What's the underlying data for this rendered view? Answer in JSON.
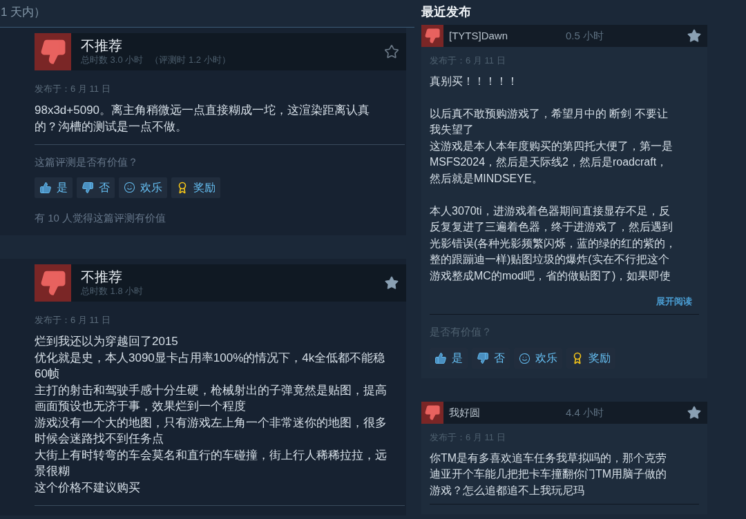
{
  "filter_label": "1 天内）",
  "left_reviews": [
    {
      "recommended": false,
      "verdict": "不推荐",
      "hours": "总时数 3.0 小时",
      "review_hours": "（评测时 1.2 小时）",
      "starred": false,
      "date": "发布于：6 月 11 日",
      "paragraphs": [
        "98x3d+5090。离主角稍微远一点直接糊成一坨，这渲染距离认真的？沟槽的测试是一点不做。"
      ],
      "helpful_prompt": "这篇评测是否有价值？",
      "buttons": [
        {
          "kind": "yes",
          "label": "是"
        },
        {
          "kind": "no",
          "label": "否"
        },
        {
          "kind": "funny",
          "label": "欢乐"
        },
        {
          "kind": "award",
          "label": "奖励"
        }
      ],
      "helpful_count": "有 10 人觉得这篇评测有价值"
    },
    {
      "recommended": false,
      "verdict": "不推荐",
      "hours": "总时数 1.8 小时",
      "starred": true,
      "date": "发布于：6 月 11 日",
      "paragraphs": [
        "烂到我还以为穿越回了2015",
        "优化就是史，本人3090显卡占用率100%的情况下，4k全低都不能稳60帧",
        "主打的射击和驾驶手感十分生硬，枪械射出的子弹竟然是贴图，提高画面预设也无济于事，效果烂到一个程度",
        "游戏没有一个大的地图，只有游戏左上角一个非常迷你的地图，很多时候会迷路找不到任务点",
        "大街上有时转弯的车会莫名和直行的车碰撞，街上行人稀稀拉拉，远景很糊",
        "这个价格不建议购买"
      ]
    }
  ],
  "recent": {
    "title": "最近发布",
    "reviews": [
      {
        "recommended": false,
        "author": "[TYTS]Dawn",
        "hours": "0.5 小时",
        "starred": true,
        "date": "发布于：6 月 11 日",
        "paragraphs": [
          "真别买！！！！！",
          {
            "spaced": true,
            "text": "以后真不敢预购游戏了，希望月中的 断剑 不要让我失望了"
          },
          "这游戏是本人本年度购买的第四托大便了，第一是MSFS2024，然后是天际线2，然后是roadcraft，然后就是MINDSEYE。",
          {
            "spaced": true,
            "text": "本人3070ti，进游戏着色器期间直接显存不足，反反复复进了三遍着色器，终于进游戏了，然后遇到光影错误(各种光影频繁闪烁，蓝的绿的红的紫的，整的跟蹦迪一样)贴图垃圾的爆炸(实在不行把这个游戏整成MC的mod吧，省的做贴图了)，如果即使"
          }
        ],
        "expand_link": "展开阅读",
        "helpful_prompt": "是否有价值？",
        "buttons": [
          {
            "kind": "yes",
            "label": "是"
          },
          {
            "kind": "no",
            "label": "否"
          },
          {
            "kind": "funny",
            "label": "欢乐"
          },
          {
            "kind": "award",
            "label": "奖励"
          }
        ]
      },
      {
        "recommended": false,
        "author": "我好圆",
        "hours": "4.4 小时",
        "starred": true,
        "date": "发布于：6 月 11 日",
        "paragraphs": [
          "你TM是有多喜欢追车任务我草拟吗的，那个克劳迪亚开个车能几把把卡车撞翻你门TM用脑子做的游戏？怎么追都追不上我玩尼玛"
        ]
      }
    ]
  }
}
